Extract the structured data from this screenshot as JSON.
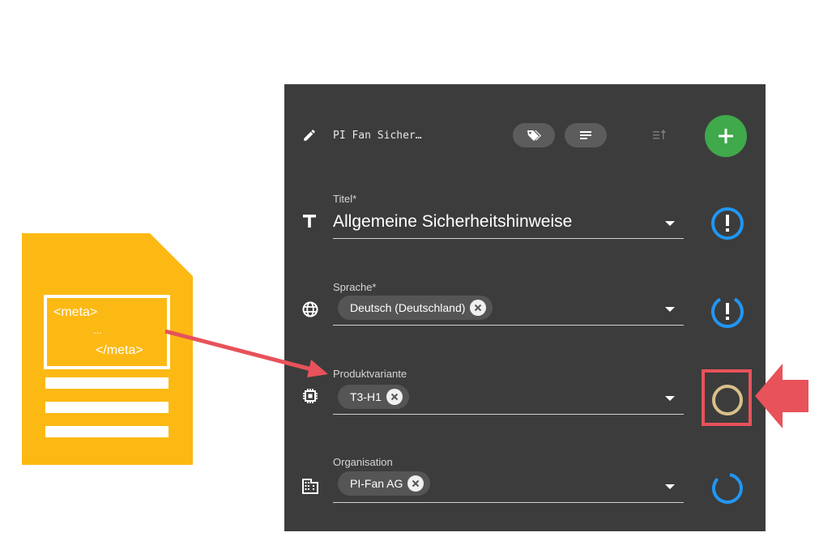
{
  "document_illustration": {
    "meta_open": "<meta>",
    "meta_ellipsis": "...",
    "meta_close": "</meta>"
  },
  "toolbar": {
    "document_name": "PI Fan Sicher…",
    "icons": [
      "edit-icon",
      "tags-icon",
      "notes-icon",
      "sort-icon",
      "plus-icon"
    ]
  },
  "fields": {
    "title": {
      "label": "Titel*",
      "value": "Allgemeine Sicherheitshinweise",
      "icon": "text-icon"
    },
    "language": {
      "label": "Sprache*",
      "chip": "Deutsch (Deutschland)",
      "icon": "globe-icon"
    },
    "variant": {
      "label": "Produktvariante",
      "chip": "T3-H1",
      "icon": "chip-icon"
    },
    "organisation": {
      "label": "Organisation",
      "chip": "PI-Fan AG",
      "icon": "building-icon"
    }
  },
  "colors": {
    "panel": "#3c3c3c",
    "accent_blue": "#2196f3",
    "add_green": "#3fa94b",
    "highlight_red": "#E8525A",
    "document_yellow": "#FDB913",
    "status_tan": "#d9c08a"
  }
}
